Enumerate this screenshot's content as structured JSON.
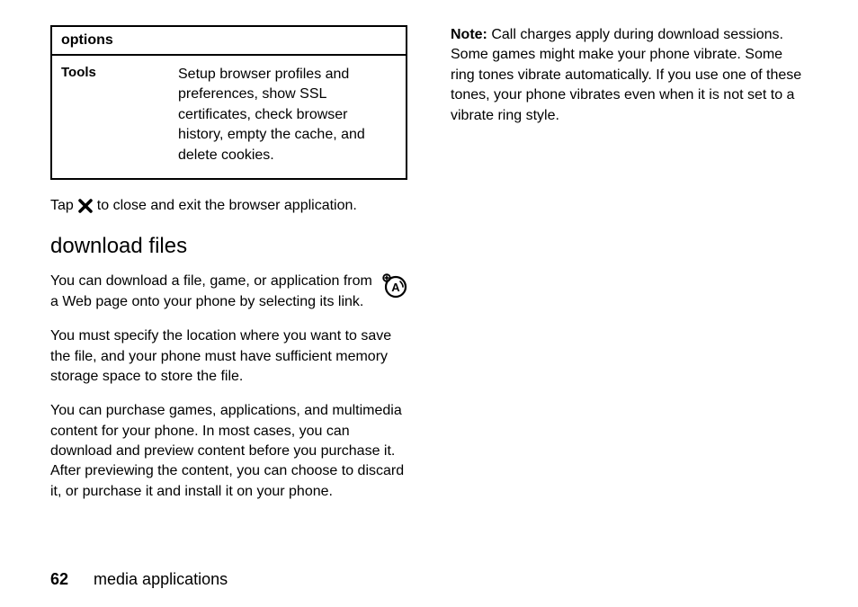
{
  "leftColumn": {
    "table": {
      "header": "options",
      "row": {
        "label": "Tools",
        "description": "Setup browser profiles and preferences, show SSL certificates, check browser history, empty the cache, and delete cookies."
      }
    },
    "tapLine": {
      "before": "Tap",
      "after": "to close and exit the browser application."
    },
    "heading": "download files",
    "intro": "You can download a file, game, or application from a Web page onto your phone by selecting its link.",
    "para2": "You must specify the location where you want to save the file, and your phone must have sufficient memory storage space to store the file.",
    "para3": "You can purchase games, applications, and multimedia content for your phone. In most cases, you can download and preview content before you purchase it. After previewing the content, you can choose to discard it, or purchase it and install it on your phone."
  },
  "rightColumn": {
    "noteLabel": "Note:",
    "noteText": " Call charges apply during download sessions. Some games might make your phone vibrate. Some ring tones vibrate automatically. If you use one of these tones, your phone vibrates even when it is not set to a vibrate ring style."
  },
  "footer": {
    "pageNumber": "62",
    "section": "media applications"
  }
}
